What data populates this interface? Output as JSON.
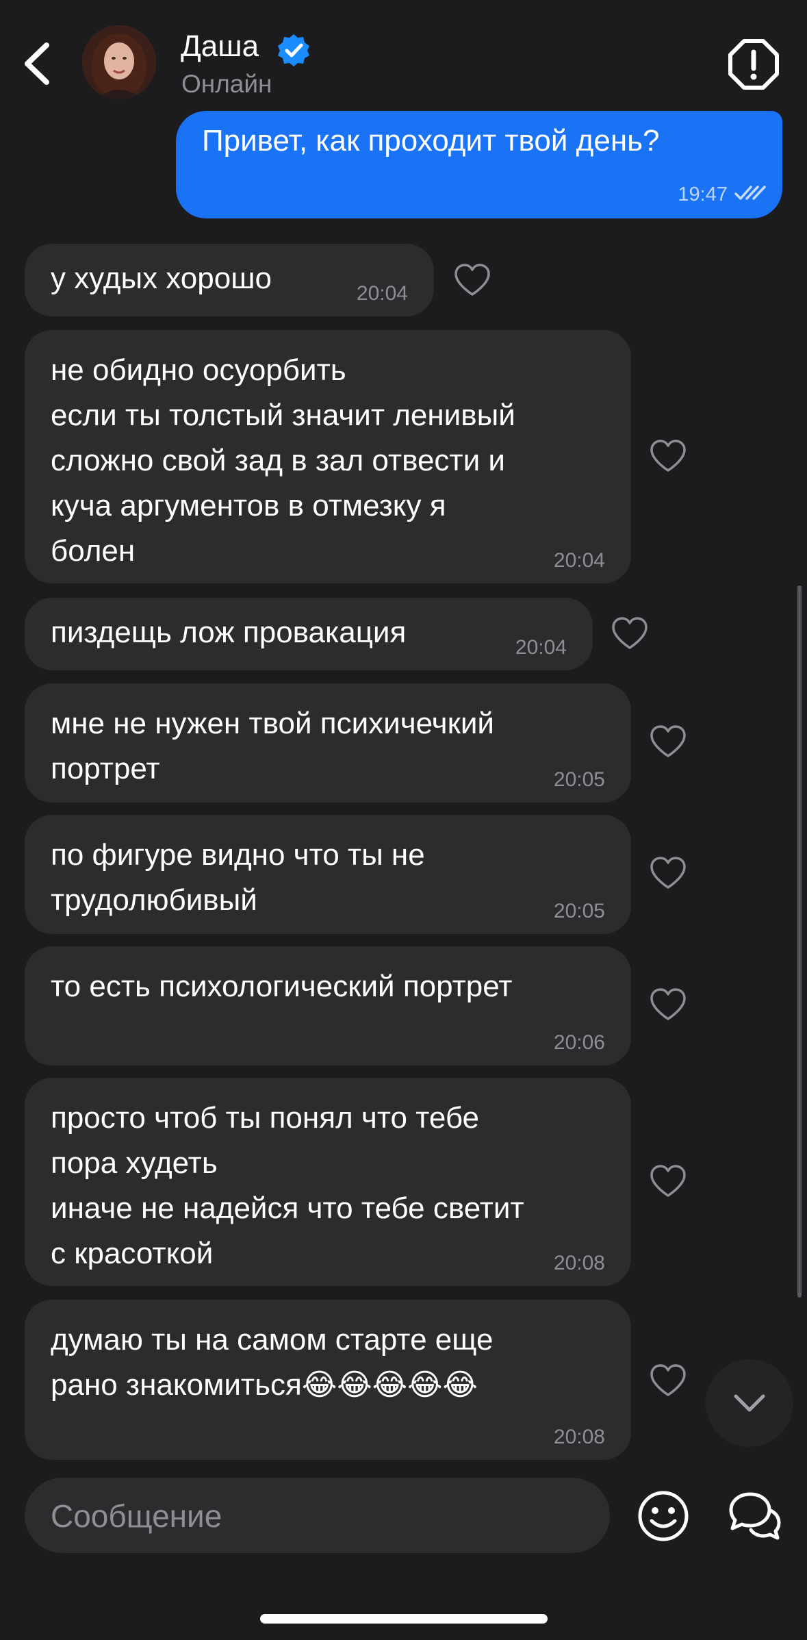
{
  "header": {
    "contact_name": "Даша",
    "status": "Онлайн"
  },
  "outgoing": [
    {
      "text": "Привет, как проходит твой день?",
      "time": "19:47"
    }
  ],
  "messages": [
    {
      "text": "у худых хорошо",
      "time": "20:04"
    },
    {
      "text": "не обидно осуорбить\nесли ты толстый значит ленивый\nсложно свой зад в зал отвести и\nкуча аргументов в отмезку я\nболен",
      "time": "20:04"
    },
    {
      "text": "пиздещь лож провакация",
      "time": "20:04"
    },
    {
      "text": "мне не нужен твой психичечкий\nпортрет",
      "time": "20:05"
    },
    {
      "text": "по фигуре видно что ты не\nтрудолюбивый",
      "time": "20:05"
    },
    {
      "text": "то есть психологический портрет",
      "time": "20:06"
    },
    {
      "text": "просто чтоб ты понял что тебе\nпора худеть\nиначе не надейся что тебе светит\nс красоткой",
      "time": "20:08"
    },
    {
      "text": "думаю ты на самом старте еще\nрано знакомиться😂😂😂😂😂",
      "time": "20:08"
    }
  ],
  "composer": {
    "placeholder": "Сообщение"
  },
  "icons": {
    "back": "chevron-left-icon",
    "verified": "verified-badge-icon",
    "report": "alert-octagon-icon",
    "like": "heart-outline-icon",
    "read": "double-check-icon",
    "scroll_down": "chevron-down-icon",
    "emoji": "smiley-icon",
    "chat": "chat-bubbles-icon"
  },
  "colors": {
    "background": "#1c1c1e",
    "outgoing_bubble": "#1a73f5",
    "incoming_bubble": "#2c2c2e",
    "verified": "#1a8cff",
    "secondary_text": "#8e8e93"
  }
}
